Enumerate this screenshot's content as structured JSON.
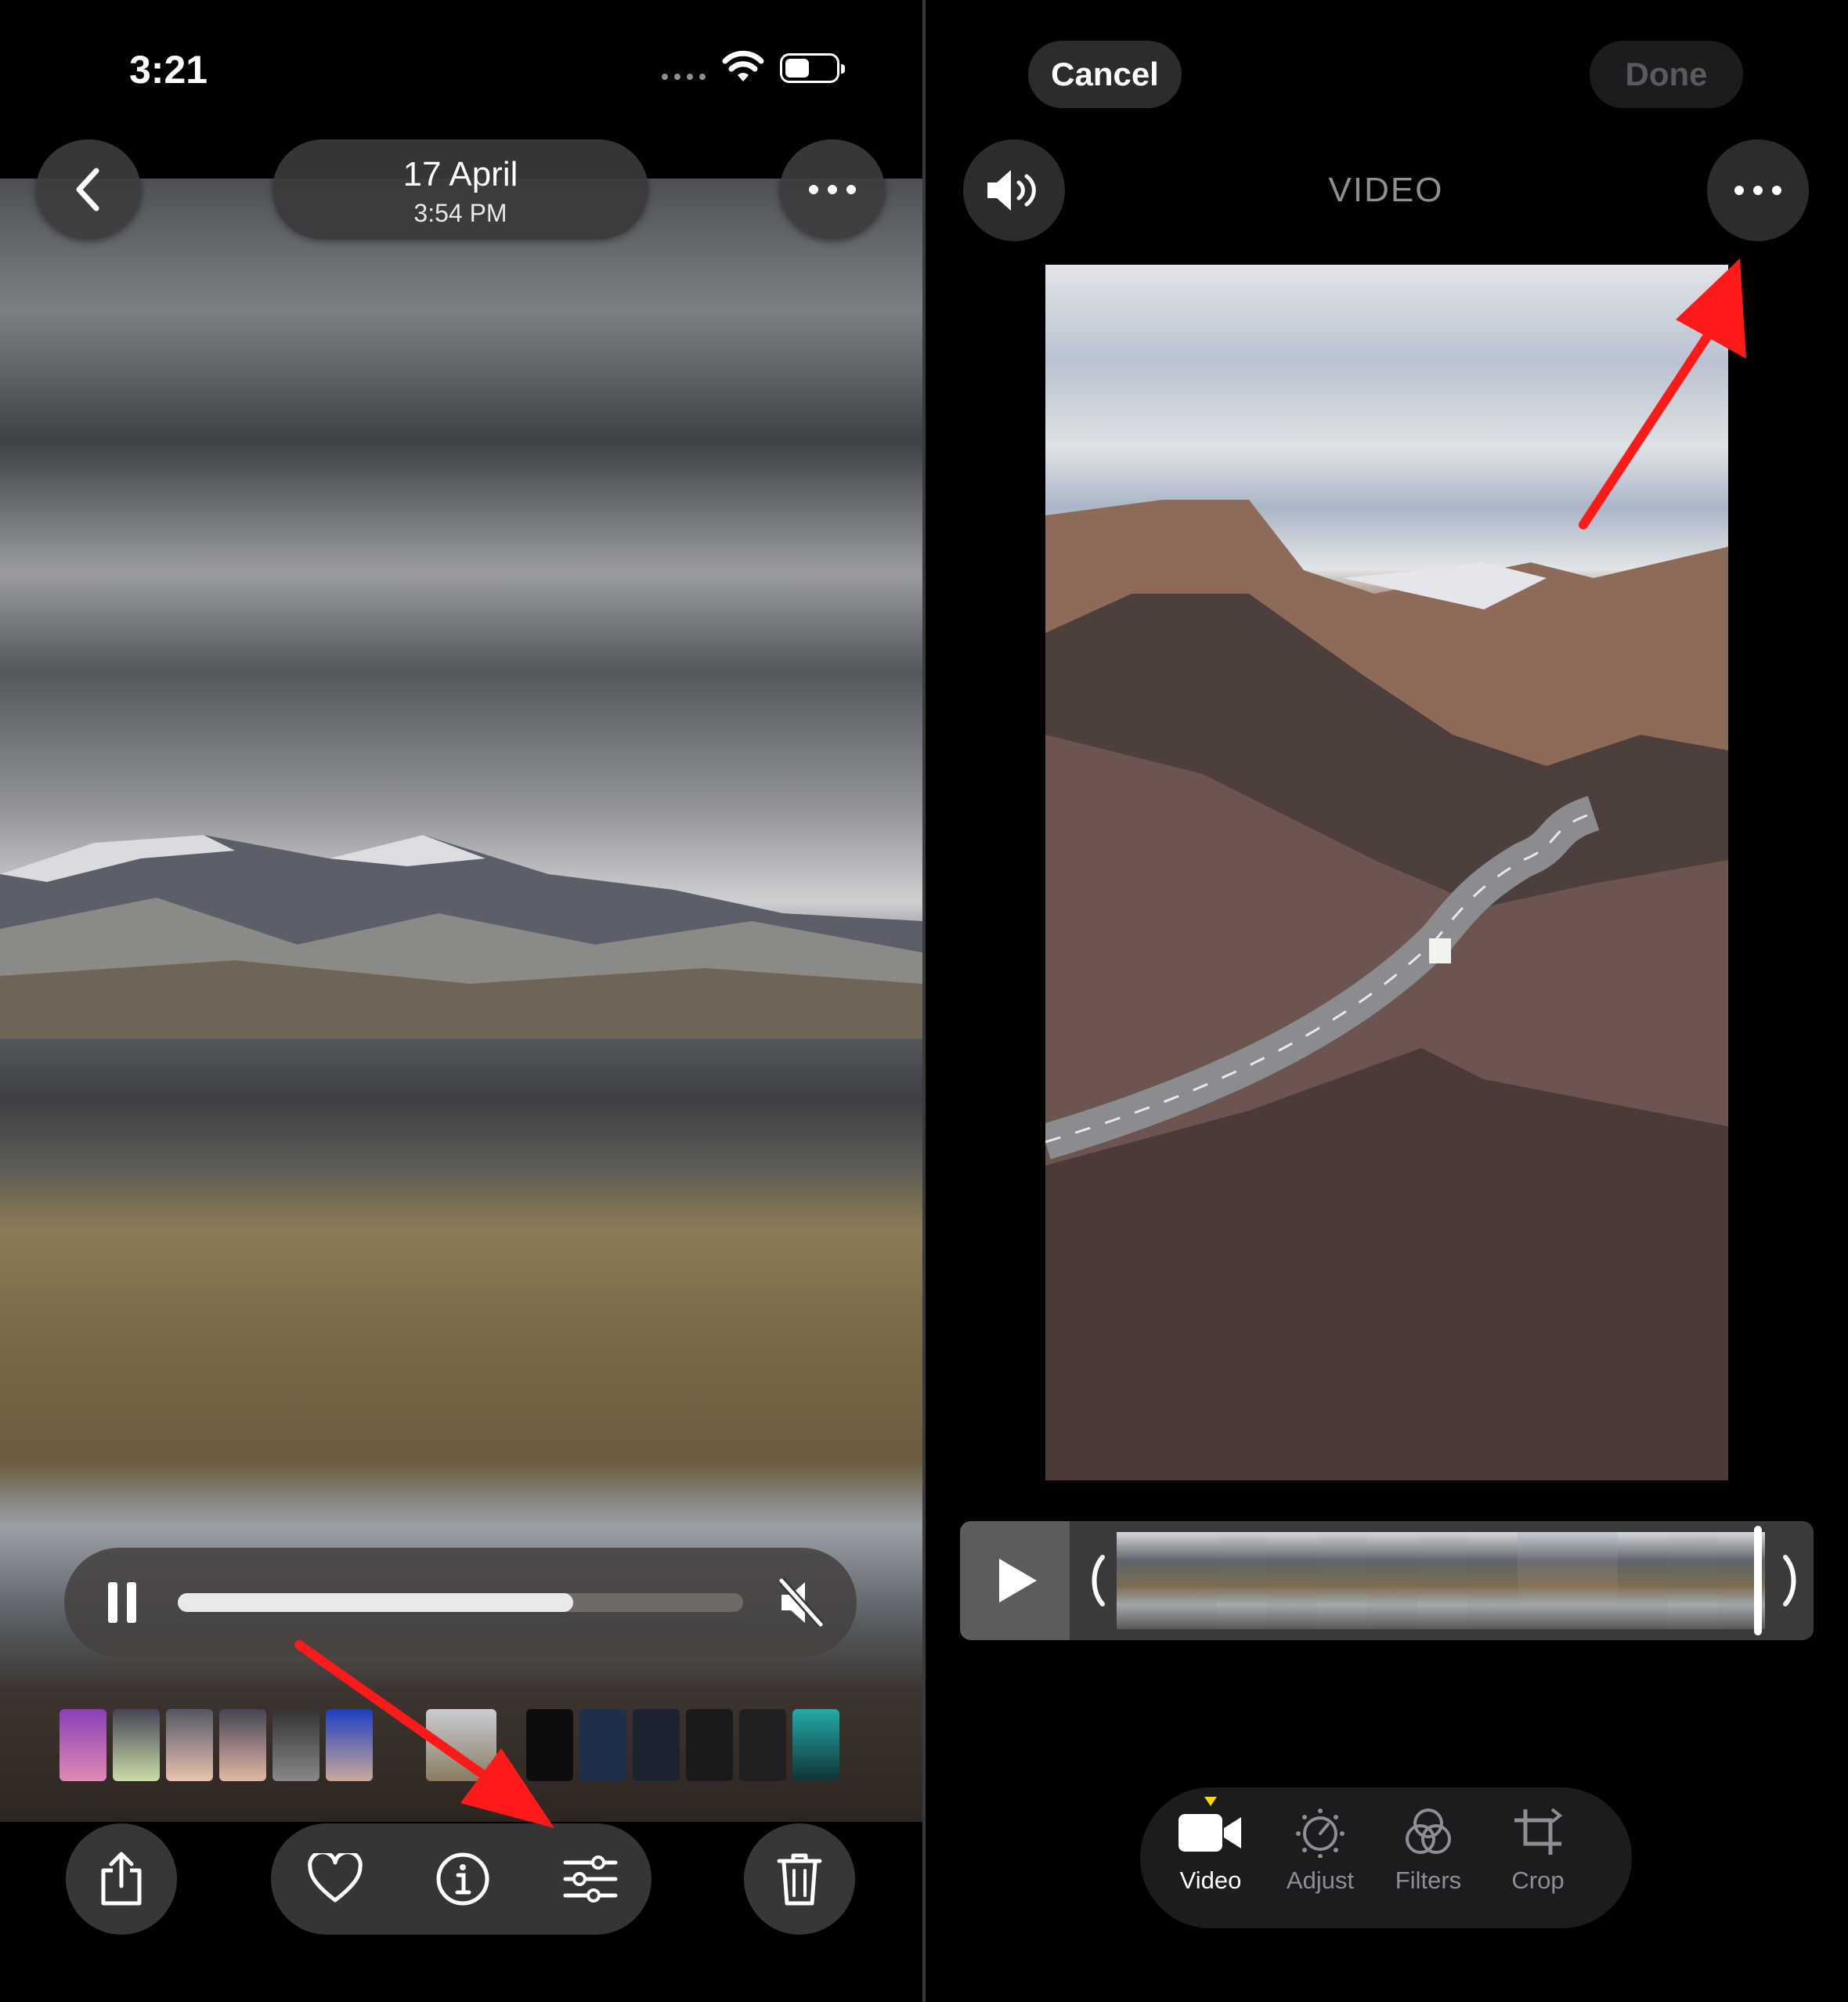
{
  "left": {
    "status_bar": {
      "time": "3:21"
    },
    "header": {
      "date": "17 April",
      "time": "3:54 PM"
    },
    "player": {
      "progress": 0.7
    },
    "toolbar": {
      "share": "share-icon",
      "favorite": "heart-icon",
      "info": "info-icon",
      "edit": "sliders-icon",
      "delete": "trash-icon"
    }
  },
  "right": {
    "top_bar": {
      "cancel_label": "Cancel",
      "done_label": "Done"
    },
    "title": "VIDEO",
    "tabs": [
      {
        "label": "Video",
        "icon": "video-camera-icon",
        "active": true
      },
      {
        "label": "Adjust",
        "icon": "adjust-dial-icon",
        "active": false
      },
      {
        "label": "Filters",
        "icon": "filters-icon",
        "active": false
      },
      {
        "label": "Crop",
        "icon": "crop-icon",
        "active": false
      }
    ]
  },
  "annotations": {
    "arrow_color": "#ff1a1a"
  }
}
